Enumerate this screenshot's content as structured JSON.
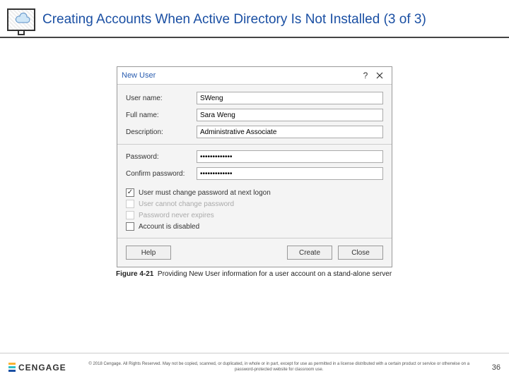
{
  "header": {
    "title": "Creating Accounts When Active Directory Is Not Installed (3 of 3)"
  },
  "dialog": {
    "title": "New User",
    "help_glyph": "?",
    "fields": {
      "username_label": "User name:",
      "username_value": "SWeng",
      "fullname_label": "Full name:",
      "fullname_value": "Sara Weng",
      "description_label": "Description:",
      "description_value": "Administrative Associate",
      "password_label": "Password:",
      "password_value": "•••••••••••••",
      "confirm_label": "Confirm password:",
      "confirm_value": "•••••••••••••"
    },
    "checks": {
      "must_change": "User must change password at next logon",
      "cannot_change": "User cannot change password",
      "never_expires": "Password never expires",
      "disabled": "Account is disabled"
    },
    "buttons": {
      "help": "Help",
      "create": "Create",
      "close": "Close"
    }
  },
  "caption": {
    "fig": "Figure 4-21",
    "text": "Providing New User information for a user account on a stand-alone server"
  },
  "footer": {
    "brand": "CENGAGE",
    "copyright": "© 2018 Cengage. All Rights Reserved. May not be copied, scanned, or duplicated, in whole or in part, except for use as permitted in a license distributed with a certain product or service or otherwise on a password-protected website for classroom use.",
    "page": "36"
  }
}
